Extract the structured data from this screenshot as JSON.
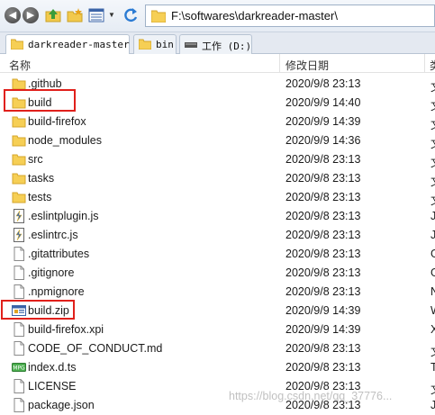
{
  "address": {
    "path": "F:\\softwares\\darkreader-master\\"
  },
  "tabs": [
    {
      "label": "darkreader-master",
      "icon": "folder-icon",
      "active": true
    },
    {
      "label": "bin",
      "icon": "folder-icon",
      "active": false
    },
    {
      "label": "工作 (D:)",
      "icon": "drive-icon",
      "active": false
    }
  ],
  "columns": {
    "name": "名称",
    "modified": "修改日期",
    "type": "类"
  },
  "files": [
    {
      "name": ".github",
      "modified": "2020/9/8 23:13",
      "type": "文",
      "icon": "folder-icon"
    },
    {
      "name": "build",
      "modified": "2020/9/9 14:40",
      "type": "文",
      "icon": "folder-icon"
    },
    {
      "name": "build-firefox",
      "modified": "2020/9/9 14:39",
      "type": "文",
      "icon": "folder-icon"
    },
    {
      "name": "node_modules",
      "modified": "2020/9/9 14:36",
      "type": "文",
      "icon": "folder-icon"
    },
    {
      "name": "src",
      "modified": "2020/9/8 23:13",
      "type": "文",
      "icon": "folder-icon"
    },
    {
      "name": "tasks",
      "modified": "2020/9/8 23:13",
      "type": "文",
      "icon": "folder-icon"
    },
    {
      "name": "tests",
      "modified": "2020/9/8 23:13",
      "type": "文",
      "icon": "folder-icon"
    },
    {
      "name": ".eslintplugin.js",
      "modified": "2020/9/8 23:13",
      "type": "J",
      "icon": "js-file-icon"
    },
    {
      "name": ".eslintrc.js",
      "modified": "2020/9/8 23:13",
      "type": "J",
      "icon": "js-file-icon"
    },
    {
      "name": ".gitattributes",
      "modified": "2020/9/8 23:13",
      "type": "G",
      "icon": "blank-file-icon"
    },
    {
      "name": ".gitignore",
      "modified": "2020/9/8 23:13",
      "type": "G",
      "icon": "blank-file-icon"
    },
    {
      "name": ".npmignore",
      "modified": "2020/9/8 23:13",
      "type": "N",
      "icon": "blank-file-icon"
    },
    {
      "name": "build.zip",
      "modified": "2020/9/9 14:39",
      "type": "W",
      "icon": "zip-file-icon"
    },
    {
      "name": "build-firefox.xpi",
      "modified": "2020/9/9 14:39",
      "type": "X",
      "icon": "blank-file-icon"
    },
    {
      "name": "CODE_OF_CONDUCT.md",
      "modified": "2020/9/8 23:13",
      "type": "文",
      "icon": "blank-file-icon"
    },
    {
      "name": "index.d.ts",
      "modified": "2020/9/8 23:13",
      "type": "T",
      "icon": "media-file-icon"
    },
    {
      "name": "LICENSE",
      "modified": "2020/9/8 23:13",
      "type": "文",
      "icon": "blank-file-icon"
    },
    {
      "name": "package.json",
      "modified": "2020/9/8 23:13",
      "type": "J",
      "icon": "blank-file-icon"
    }
  ],
  "watermark": "https://blog.csdn.net/qq_37776..."
}
